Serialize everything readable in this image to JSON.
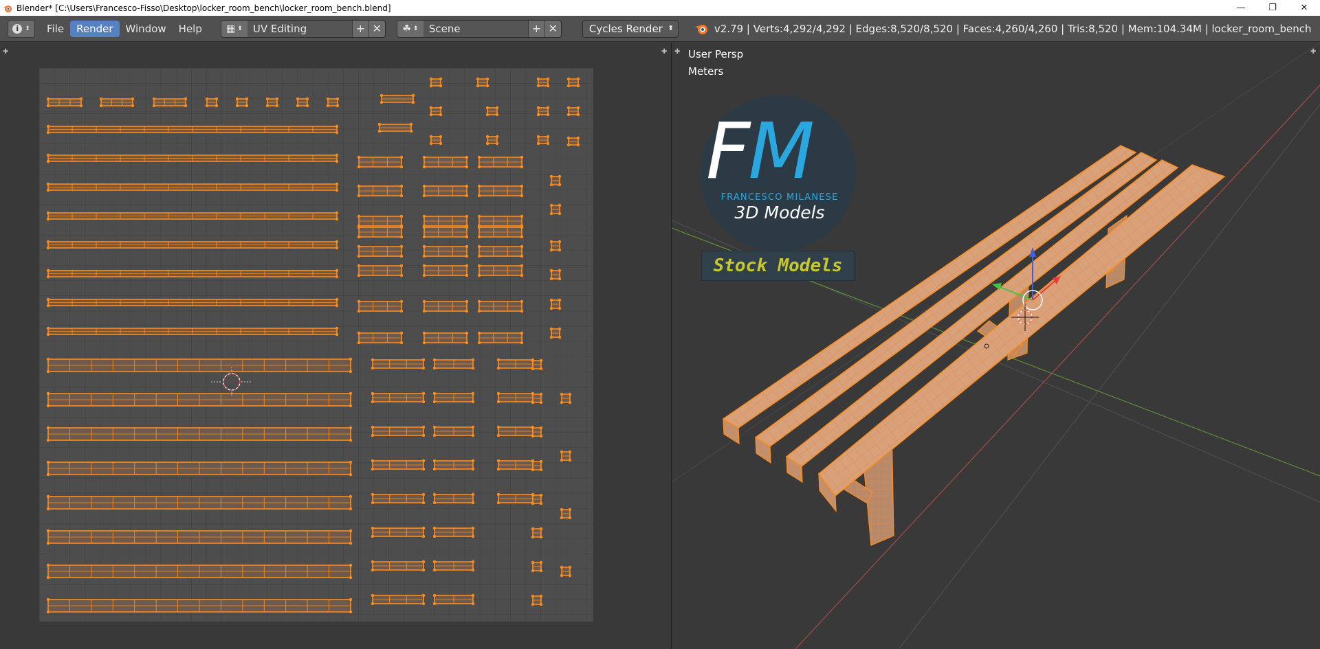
{
  "window": {
    "title": "Blender* [C:\\Users\\Francesco-Fisso\\Desktop\\locker_room_bench\\locker_room_bench.blend]",
    "minimize_icon": "minimize-icon",
    "restore_icon": "restore-icon",
    "close_icon": "close-icon"
  },
  "menu": {
    "file": "File",
    "render": "Render",
    "window": "Window",
    "help": "Help"
  },
  "screen_layout": {
    "value": "UV Editing"
  },
  "scene": {
    "value": "Scene"
  },
  "render_engine": {
    "value": "Cycles Render"
  },
  "stats": "v2.79 | Verts:4,292/4,292 | Edges:8,520/8,520 | Faces:4,260/4,260 | Tris:8,520 | Mem:104.34M | locker_room_bench",
  "viewport": {
    "view_name": "User Persp",
    "units": "Meters"
  },
  "logo": {
    "letter_f": "F",
    "letter_m": "M",
    "name": "FRANCESCO MILANESE",
    "subtitle": "3D Models",
    "banner": "Stock Models"
  },
  "colors": {
    "accent": "#5680c2",
    "selection": "#ff8c1a",
    "face_fill": "#d9a17a",
    "background": "#393939",
    "brand_blue": "#2ba7df",
    "banner_text": "#c9c82a"
  }
}
